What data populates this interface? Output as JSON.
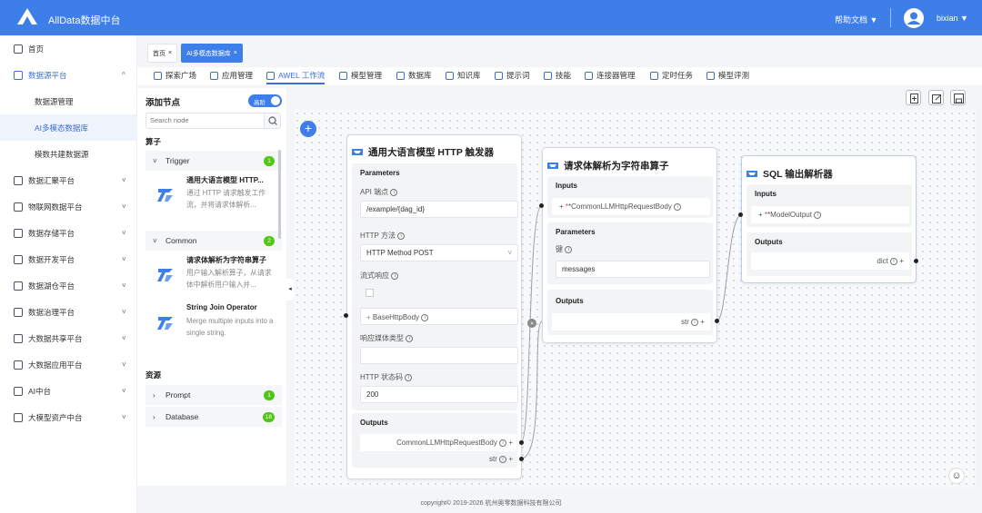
{
  "header": {
    "title": "AllData数据中台",
    "help": "帮助文档 ▼",
    "user": "bixian ▼"
  },
  "sidebar": {
    "items": [
      {
        "label": "首页",
        "chev": ""
      },
      {
        "label": "数据源平台",
        "chev": "^"
      },
      {
        "label": "数据汇聚平台",
        "chev": "˅"
      },
      {
        "label": "物联网数据平台",
        "chev": "˅"
      },
      {
        "label": "数据存储平台",
        "chev": "˅"
      },
      {
        "label": "数据开发平台",
        "chev": "˅"
      },
      {
        "label": "数据湖仓平台",
        "chev": "˅"
      },
      {
        "label": "数据治理平台",
        "chev": "˅"
      },
      {
        "label": "大数据共享平台",
        "chev": "˅"
      },
      {
        "label": "大数据应用平台",
        "chev": "˅"
      },
      {
        "label": "AI中台",
        "chev": "˅"
      },
      {
        "label": "大模型资产中台",
        "chev": "˅"
      }
    ],
    "subitems": [
      "数据源管理",
      "AI多模态数据库",
      "模数共建数据源"
    ]
  },
  "page_tabs": [
    {
      "label": "首页"
    },
    {
      "label": "AI多模态数据库"
    }
  ],
  "nav_tabs": [
    "探索广场",
    "应用管理",
    "AWEL 工作流",
    "模型管理",
    "数据库",
    "知识库",
    "提示词",
    "技能",
    "连接器管理",
    "定时任务",
    "模型评测"
  ],
  "panel": {
    "title": "添加节点",
    "toggle": "高阶",
    "search_placeholder": "Search node",
    "section_ops": "算子",
    "section_res": "资源",
    "groups": [
      {
        "label": "Trigger",
        "count": "1"
      },
      {
        "label": "Common",
        "count": "2"
      },
      {
        "label": "Prompt",
        "count": "1"
      },
      {
        "label": "Database",
        "count": "18"
      }
    ],
    "items": [
      {
        "title": "通用大语言模型 HTTP...",
        "desc": "通过 HTTP 请求触发工作流，并将请求体解析..."
      },
      {
        "title": "请求体解析为字符串算子",
        "desc": "用户输入解析算子，从请求体中解析用户输入并..."
      },
      {
        "title": "String Join Operator",
        "desc": "Merge multiple inputs into a single string."
      }
    ]
  },
  "nodes": {
    "http": {
      "title": "通用大语言模型 HTTP 触发器",
      "params": "Parameters",
      "api_label": "API 端点",
      "api_value": "/example/{dag_id}",
      "method_label": "HTTP 方法",
      "method_value": "HTTP Method POST",
      "stream_label": "流式响应",
      "body": "BaseHttpBody",
      "media_label": "响应媒体类型",
      "status_label": "HTTP 状态码",
      "status_value": "200",
      "outputs": "Outputs",
      "out1": "CommonLLMHttpRequestBody",
      "out2": "str"
    },
    "parse": {
      "title": "请求体解析为字符串算子",
      "inputs": "Inputs",
      "in1": "*CommonLLMHttpRequestBody",
      "params": "Parameters",
      "key_label": "键",
      "key_value": "messages",
      "outputs": "Outputs",
      "out1": "str"
    },
    "sql": {
      "title": "SQL 输出解析器",
      "inputs": "Inputs",
      "in1": "*ModelOutput",
      "outputs": "Outputs",
      "out1": "dict"
    }
  },
  "footer": "copyright© 2019-2026 杭州奥零数据科技有限公司",
  "colors": {
    "primary": "#3d7ee8",
    "badge": "#52c41a"
  }
}
